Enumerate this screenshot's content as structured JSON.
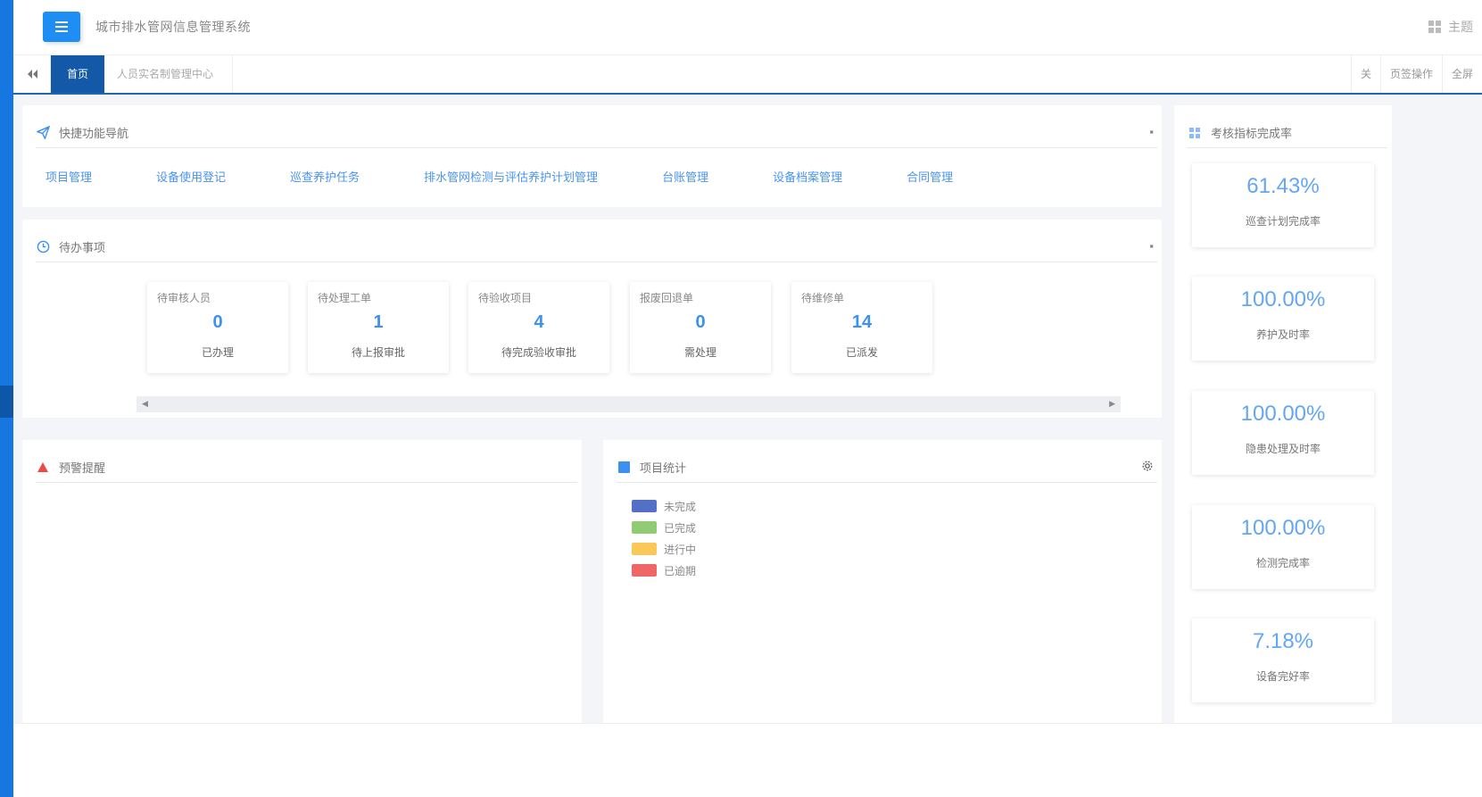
{
  "header": {
    "title": "城市排水管网信息管理系统",
    "menu_icon": "menu-icon",
    "right_grid_icon": "grid-icon",
    "right_label": "主题"
  },
  "tabs": {
    "back_icon": "double-left-icon",
    "items": [
      {
        "label": "首页"
      },
      {
        "label": "人员实名制管理中心"
      }
    ],
    "tools": [
      {
        "label": "关"
      },
      {
        "label": "页签操作"
      },
      {
        "label": "全屏"
      }
    ]
  },
  "quick_links": {
    "title": "快捷功能导航",
    "icon": "paper-plane-icon",
    "items": [
      "项目管理",
      "设备使用登记",
      "巡查养护任务",
      "排水管网检测与评估养护计划管理",
      "台账管理",
      "设备档案管理",
      "合同管理"
    ]
  },
  "todo": {
    "title": "待办事项",
    "icon": "clock-icon",
    "cards": [
      {
        "title": "待审核人员",
        "value": "0",
        "sub": "已办理"
      },
      {
        "title": "待处理工单",
        "value": "1",
        "sub": "待上报审批"
      },
      {
        "title": "待验收项目",
        "value": "4",
        "sub": "待完成验收审批"
      },
      {
        "title": "报废回退单",
        "value": "0",
        "sub": "需处理"
      },
      {
        "title": "待维修单",
        "value": "14",
        "sub": "已派发"
      }
    ]
  },
  "alerts": {
    "title": "预警提醒",
    "icon": "warning-icon"
  },
  "stats": {
    "title": "项目统计",
    "icon": "chart-icon",
    "legend": [
      {
        "label": "未完成",
        "color": "#5470c6"
      },
      {
        "label": "已完成",
        "color": "#91cc75"
      },
      {
        "label": "进行中",
        "color": "#fac858"
      },
      {
        "label": "已逾期",
        "color": "#ee6666"
      }
    ]
  },
  "rates": {
    "title": "考核指标完成率",
    "icon": "grid-small-icon",
    "cards": [
      {
        "value": "61.43%",
        "label": "巡查计划完成率"
      },
      {
        "value": "100.00%",
        "label": "养护及时率"
      },
      {
        "value": "100.00%",
        "label": "隐患处理及时率"
      },
      {
        "value": "100.00%",
        "label": "检测完成率"
      },
      {
        "value": "7.18%",
        "label": "设备完好率"
      }
    ]
  }
}
